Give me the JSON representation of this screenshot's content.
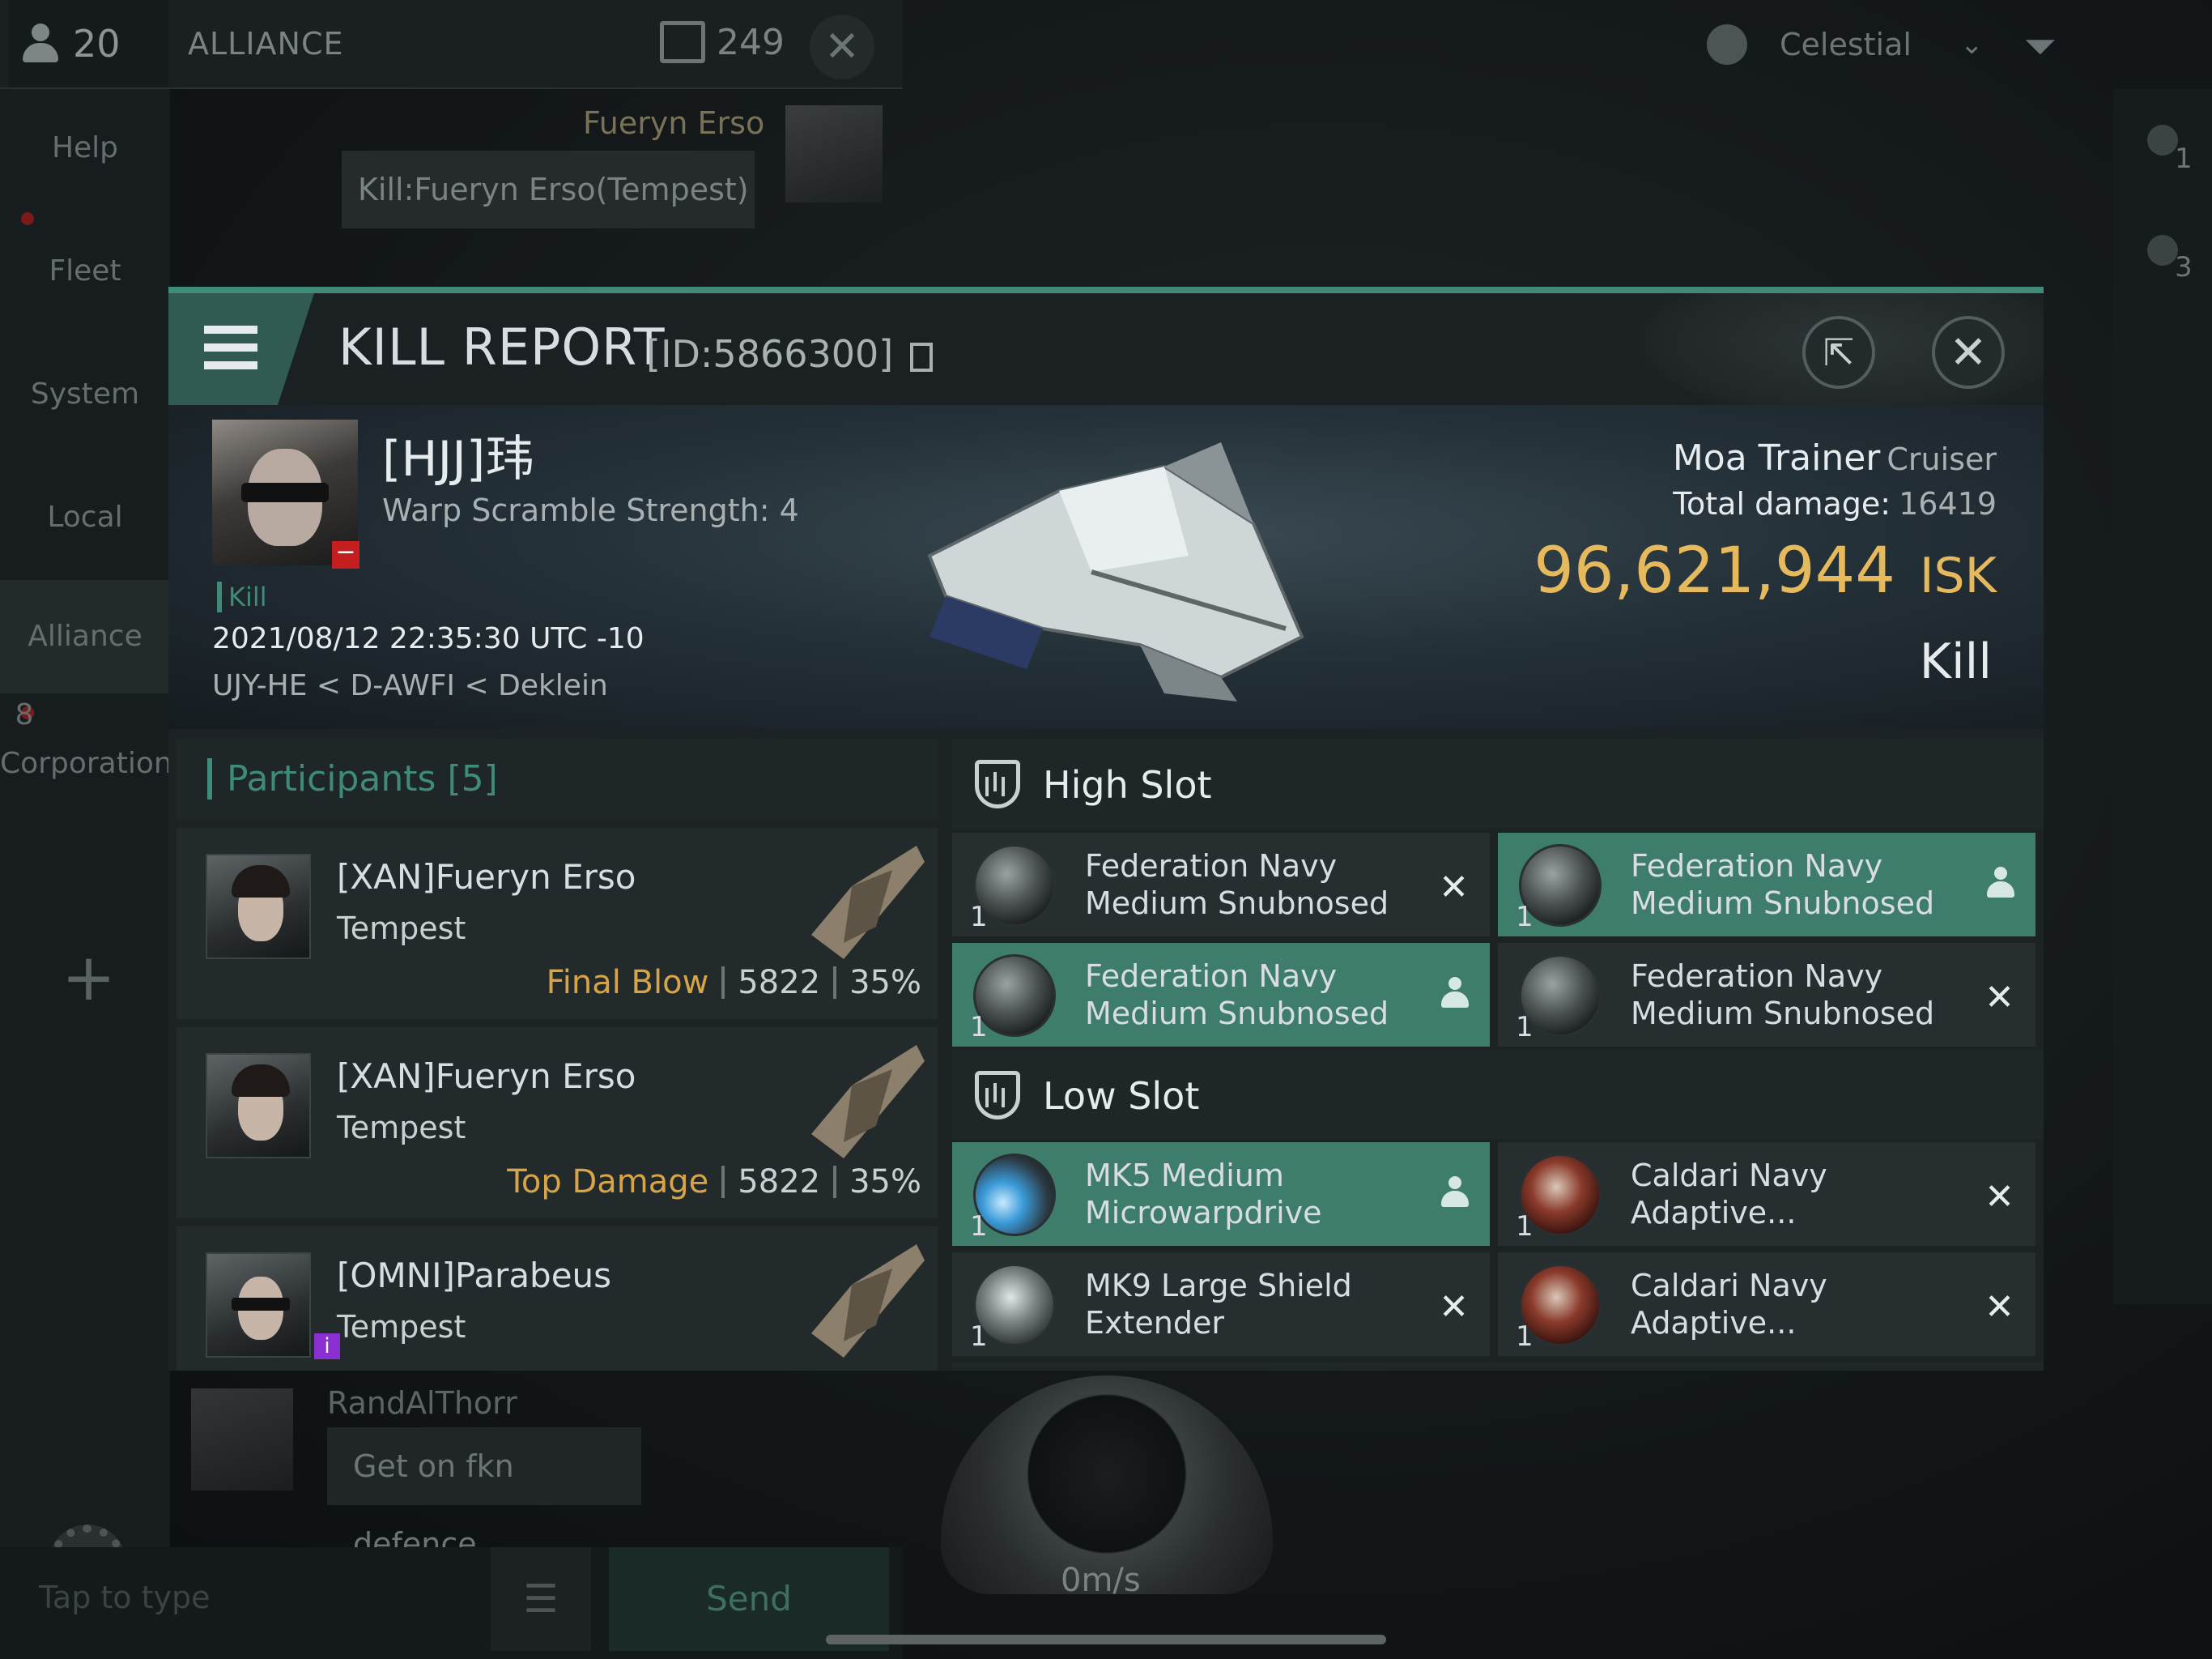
{
  "topbar": {
    "player_count": "20",
    "channel": "ALLIANCE",
    "message_count": "249",
    "close_icon": "close-icon"
  },
  "overview": {
    "filter_label": "Celestial",
    "badges": [
      "1",
      "3"
    ]
  },
  "leftnav": {
    "items": [
      "Help",
      "Fleet",
      "System",
      "Local",
      "Alliance",
      "Corporation"
    ],
    "corporation_unread": "8"
  },
  "chat": {
    "top_sender": "Fueryn Erso",
    "top_message": "Kill:Fueryn Erso(Tempest)",
    "bottom_sender": "RandAlThorr",
    "bottom_message": "Get on fkn defence",
    "input_placeholder": "Tap to type",
    "send_label": "Send"
  },
  "hud": {
    "speed": "0m/s"
  },
  "report": {
    "title": "KILL REPORT",
    "id": "[ID:5866300]",
    "victim": {
      "name": "[HJJ]玮",
      "warp_scramble": "Warp Scramble Strength: 4",
      "tag": "Kill",
      "datetime": "2021/08/12 22:35:30 UTC -10",
      "location": "UJY-HE < D-AWFI < Deklein"
    },
    "ship": {
      "name": "Moa Trainer",
      "class": "Cruiser",
      "total_damage_label": "Total damage:",
      "total_damage": "16419",
      "isk_value": "96,621,944",
      "isk_unit": "ISK",
      "result": "Kill"
    },
    "participants": {
      "title": "Participants [5]",
      "rows": [
        {
          "name": "[XAN]Fueryn Erso",
          "ship": "Tempest",
          "tag": "Final Blow",
          "damage": "5822",
          "percent": "35%"
        },
        {
          "name": "[XAN]Fueryn Erso",
          "ship": "Tempest",
          "tag": "Top Damage",
          "damage": "5822",
          "percent": "35%"
        },
        {
          "name": "[OMNI]Parabeus",
          "ship": "Tempest",
          "tag": "",
          "damage": "",
          "percent": ""
        }
      ]
    },
    "high_slot": {
      "title": "High Slot",
      "modules": [
        {
          "line1": "Federation Navy",
          "line2": "Medium Snubnosed ...",
          "qty": "1",
          "status": "destroyed"
        },
        {
          "line1": "Federation Navy",
          "line2": "Medium Snubnosed ...",
          "qty": "1",
          "status": "dropped"
        },
        {
          "line1": "Federation Navy",
          "line2": "Medium Snubnosed ...",
          "qty": "1",
          "status": "dropped"
        },
        {
          "line1": "Federation Navy",
          "line2": "Medium Snubnosed ...",
          "qty": "1",
          "status": "destroyed"
        }
      ]
    },
    "low_slot": {
      "title": "Low Slot",
      "modules": [
        {
          "line1": "MK5 Medium",
          "line2": "Microwarpdrive",
          "qty": "1",
          "status": "dropped"
        },
        {
          "line1": "Caldari Navy",
          "line2": "Adaptive...",
          "qty": "1",
          "status": "destroyed"
        },
        {
          "line1": "MK9 Large Shield",
          "line2": "Extender",
          "qty": "1",
          "status": "destroyed"
        },
        {
          "line1": "Caldari Navy",
          "line2": "Adaptive...",
          "qty": "1",
          "status": "destroyed"
        }
      ]
    }
  }
}
